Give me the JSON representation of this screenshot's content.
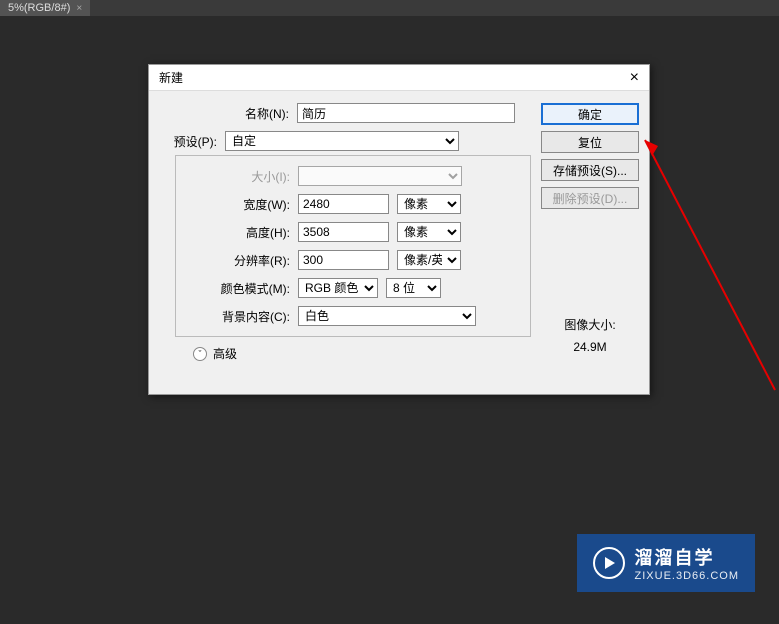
{
  "tab": {
    "label": "5%(RGB/8#)",
    "close": "×"
  },
  "dialog": {
    "title": "新建",
    "close": "×",
    "labels": {
      "name": "名称(N):",
      "preset": "预设(P):",
      "size": "大小(I):",
      "width": "宽度(W):",
      "height": "高度(H):",
      "resolution": "分辨率(R):",
      "colorMode": "颜色模式(M):",
      "bgContent": "背景内容(C):"
    },
    "values": {
      "name": "简历",
      "preset": "自定",
      "width": "2480",
      "height": "3508",
      "resolution": "300",
      "widthUnit": "像素",
      "heightUnit": "像素",
      "resUnit": "像素/英寸",
      "colorMode": "RGB 颜色",
      "bitDepth": "8 位",
      "bg": "白色"
    },
    "advanced": "高级",
    "buttons": {
      "ok": "确定",
      "reset": "复位",
      "savePreset": "存储预设(S)...",
      "deletePreset": "删除预设(D)..."
    },
    "imageSize": {
      "label": "图像大小:",
      "value": "24.9M"
    }
  },
  "watermark": {
    "title": "溜溜自学",
    "url": "ZIXUE.3D66.COM"
  }
}
